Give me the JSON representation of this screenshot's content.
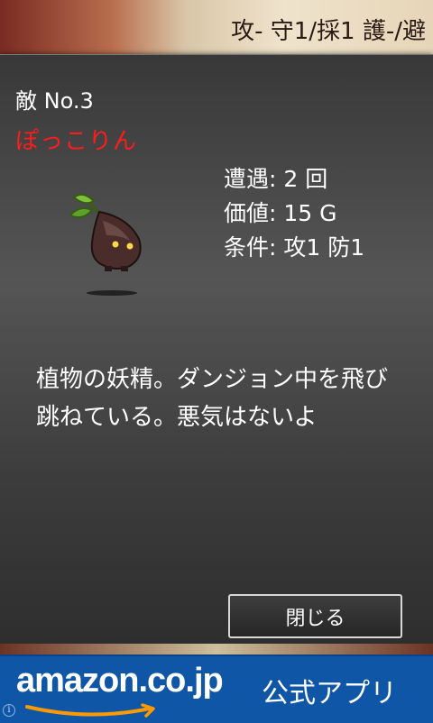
{
  "header": {
    "stats_text": "攻- 守1/採1 護-/避"
  },
  "enemy": {
    "number_label": "敵 No.3",
    "name": "ぽっこりん",
    "sprite_icon": "leaf-sprout-creature-icon",
    "stats": {
      "encounters": "遭遇: 2 回",
      "value": "価値: 15 G",
      "condition": "条件: 攻1 防1"
    },
    "description": "植物の妖精。ダンジョン中を飛び跳ねている。悪気はないよ"
  },
  "actions": {
    "close_label": "閉じる"
  },
  "ad": {
    "logo_text": "amazon.co.jp",
    "tagline": "公式アプリ",
    "info_icon": "i",
    "colors": {
      "background": "#0f56a6",
      "text": "#ffffff"
    }
  },
  "colors": {
    "enemy_name": "#ff1c1c",
    "panel": "#4a4a4a"
  }
}
